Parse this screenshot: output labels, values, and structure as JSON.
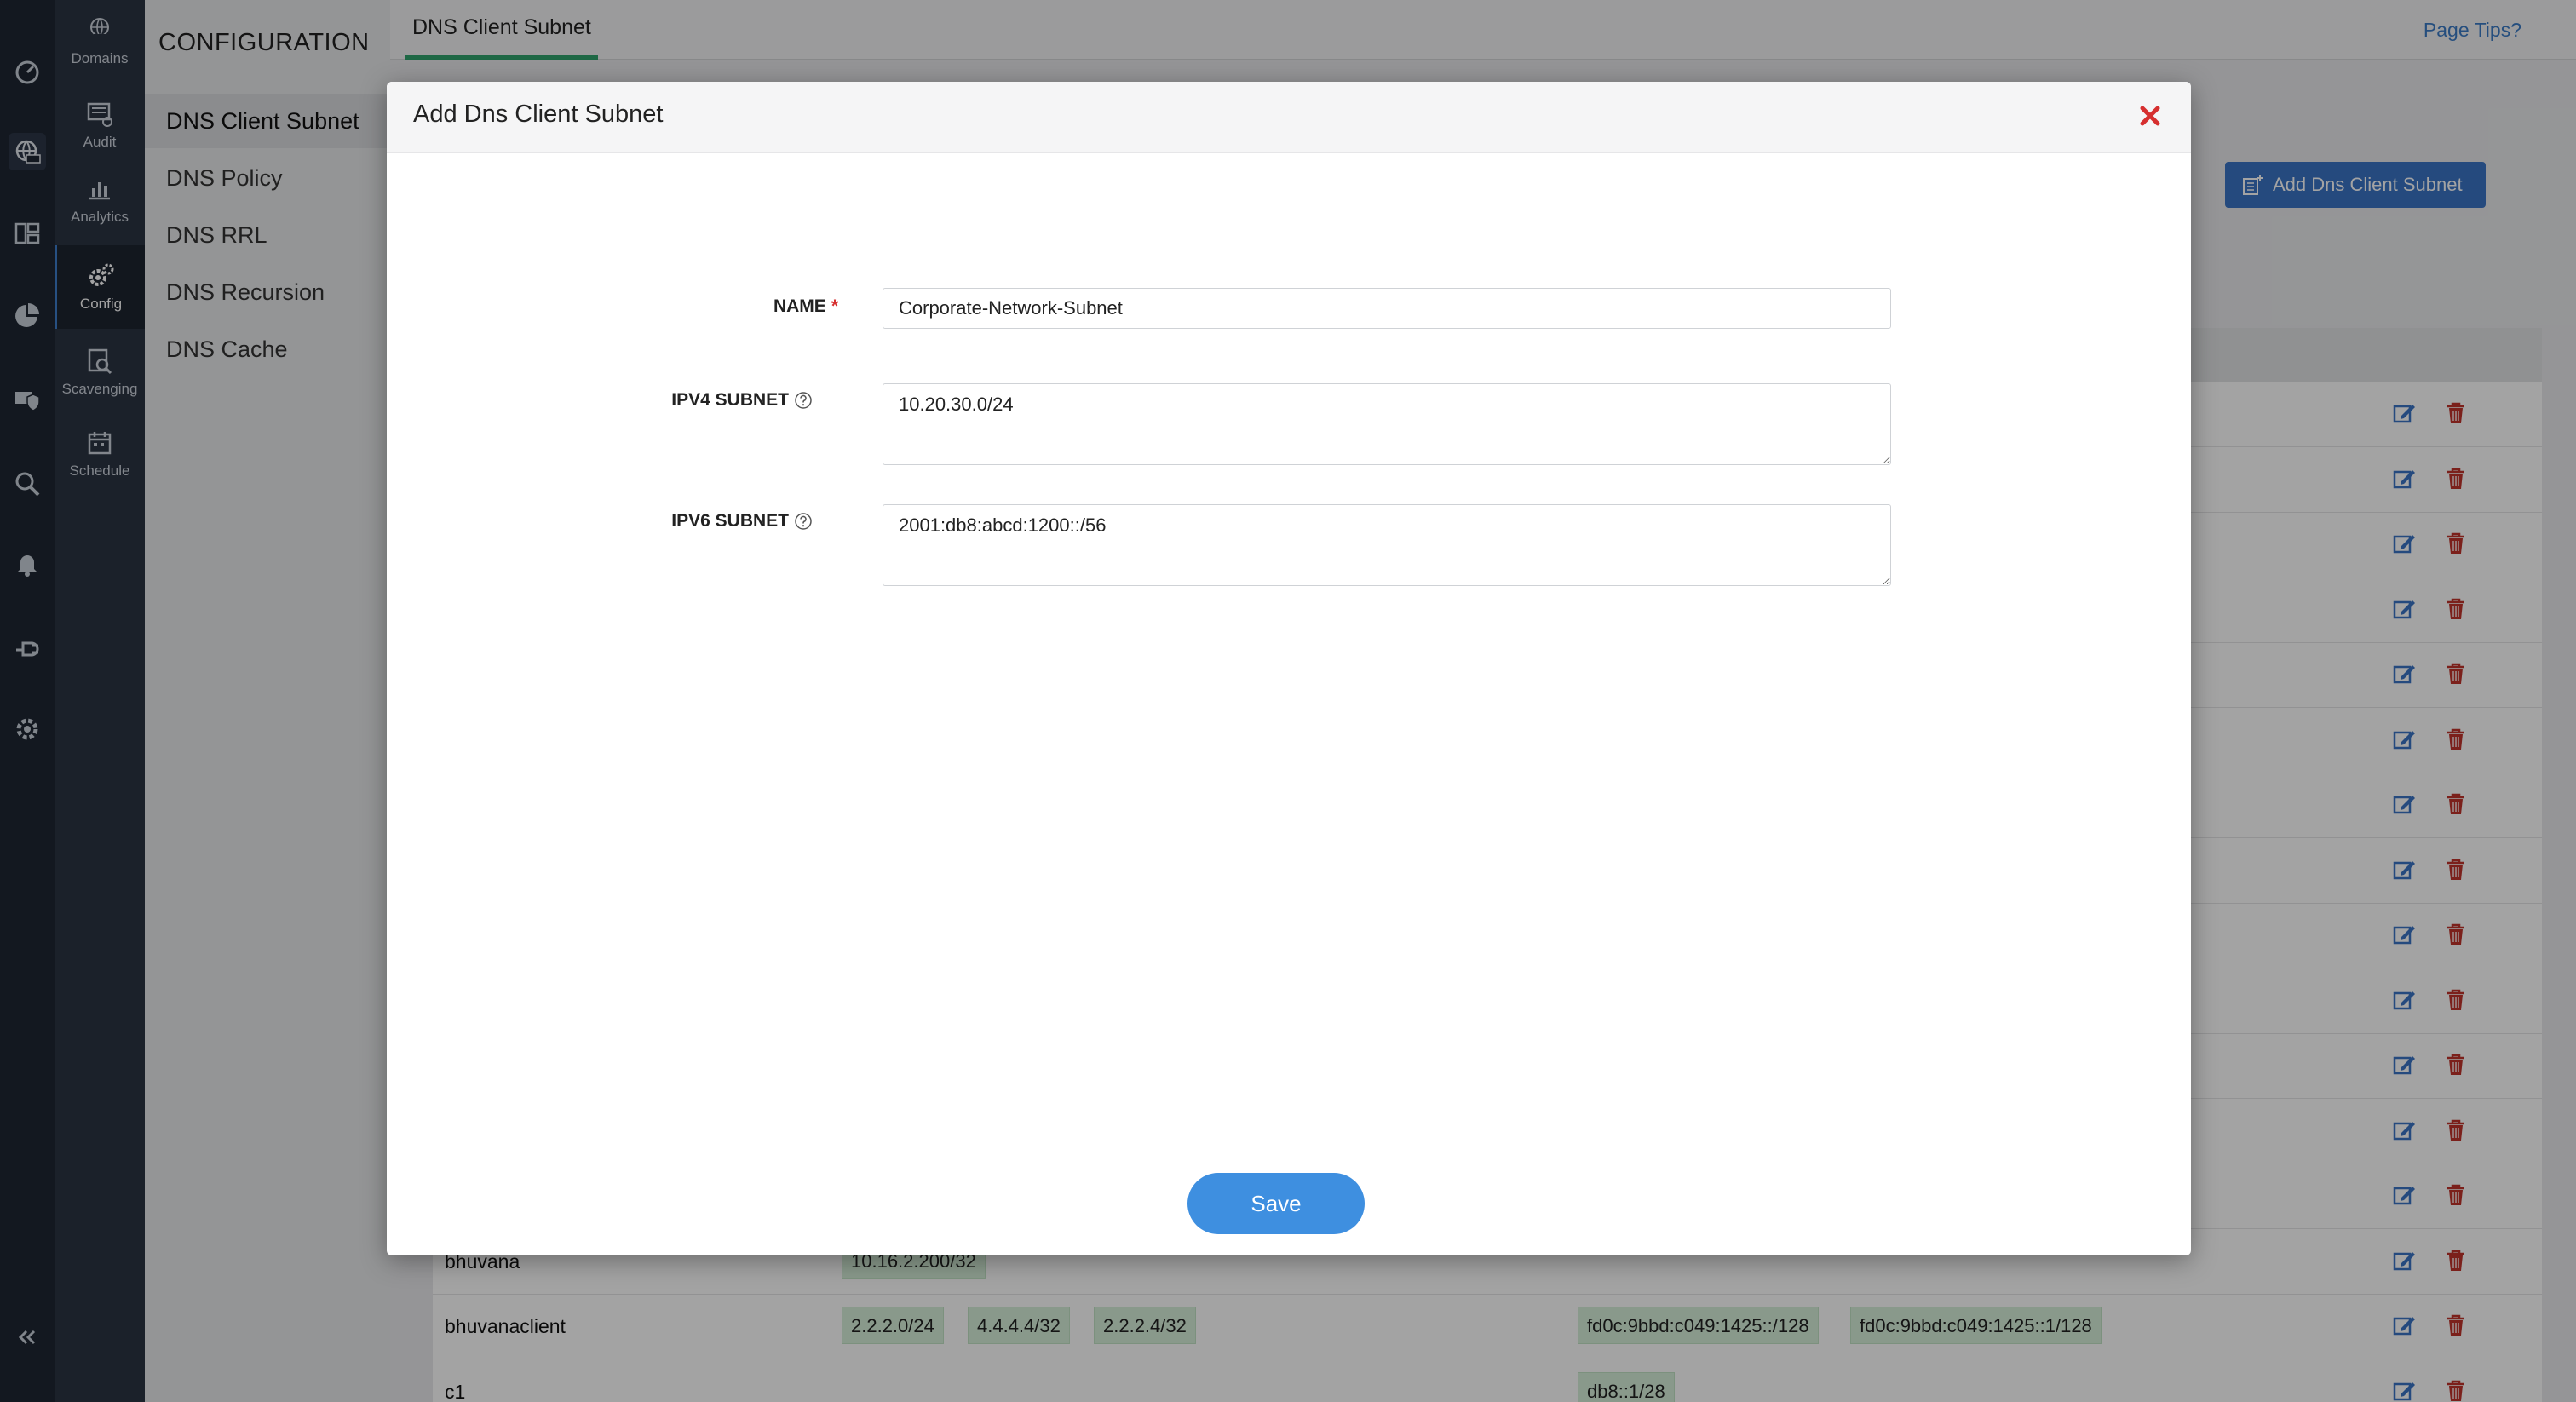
{
  "rail": {
    "icons": [
      "dashboard-icon",
      "dns-globe-icon",
      "ip-management-icon",
      "reports-pie-icon",
      "security-shield-icon",
      "search-discovery-icon",
      "bell-icon",
      "plug-icon",
      "settings-gear-icon",
      "collapse-chevrons-icon"
    ]
  },
  "nav2": {
    "items": [
      {
        "label": "Domains",
        "icon": "globe-com-icon"
      },
      {
        "label": "Audit",
        "icon": "audit-icon"
      },
      {
        "label": "Analytics",
        "icon": "bar-chart-icon"
      },
      {
        "label": "Config",
        "icon": "gears-icon"
      },
      {
        "label": "Scavenging",
        "icon": "scavenging-icon"
      },
      {
        "label": "Schedule",
        "icon": "calendar-icon"
      }
    ]
  },
  "sidebar": {
    "title": "CONFIGURATION",
    "items": [
      {
        "label": "DNS Client Subnet"
      },
      {
        "label": "DNS Policy"
      },
      {
        "label": "DNS RRL"
      },
      {
        "label": "DNS Recursion"
      },
      {
        "label": "DNS Cache"
      }
    ]
  },
  "main": {
    "active_tab": "DNS Client Subnet",
    "page_tips": "Page Tips?",
    "add_button_label": "Add Dns Client Subnet",
    "visible_rows": [
      {
        "name": "bhuvana",
        "ipv4": [
          "10.16.2.200/32"
        ],
        "ipv6": []
      },
      {
        "name": "bhuvanaclient",
        "ipv4": [
          "2.2.2.0/24",
          "4.4.4.4/32",
          "2.2.2.4/32"
        ],
        "ipv6": [
          "fd0c:9bbd:c049:1425::/128",
          "fd0c:9bbd:c049:1425::1/128"
        ]
      },
      {
        "name": "c1",
        "ipv4": [],
        "ipv6": [
          "db8::1/28"
        ]
      }
    ]
  },
  "modal": {
    "title": "Add Dns Client Subnet",
    "fields": {
      "name_label": "NAME",
      "required_mark": "*",
      "name_value": "Corporate-Network-Subnet",
      "ipv4_label": "IPV4 SUBNET",
      "ipv4_value": "10.20.30.0/24",
      "ipv6_label": "IPV6 SUBNET",
      "ipv6_value": "2001:db8:abcd:1200::/56"
    },
    "save_label": "Save"
  },
  "colors": {
    "rail_bg": "#1e2633",
    "accent_blue": "#3e8fe0",
    "tab_underline": "#2fa36c",
    "close_red": "#d62f2f",
    "chip_green": "#d6f0d9"
  }
}
